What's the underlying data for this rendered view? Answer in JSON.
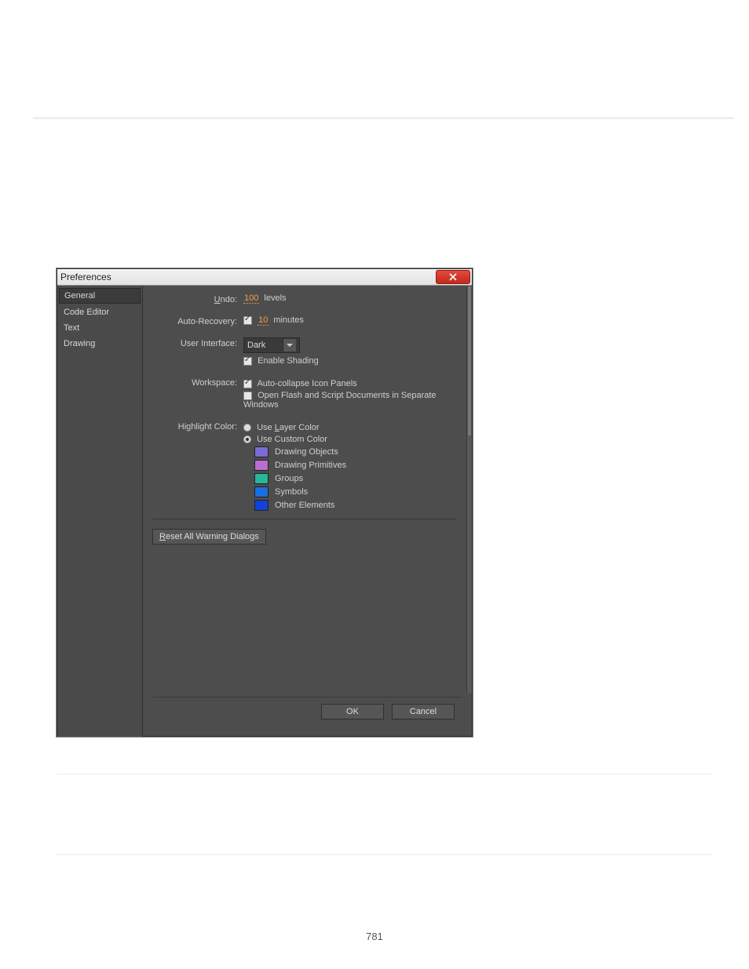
{
  "page": {
    "number": "781"
  },
  "dialog": {
    "title": "Preferences",
    "sidebar": {
      "items": [
        {
          "label": "General",
          "selected": true
        },
        {
          "label": "Code Editor",
          "selected": false
        },
        {
          "label": "Text",
          "selected": false
        },
        {
          "label": "Drawing",
          "selected": false
        }
      ]
    },
    "general": {
      "undo": {
        "label_pre": "U",
        "label_post": "ndo:",
        "value": "100",
        "units": "levels"
      },
      "auto_recovery": {
        "label": "Auto-Recovery:",
        "checked": true,
        "value": "10",
        "units": "minutes"
      },
      "user_interface": {
        "label": "User Interface:",
        "selected": "Dark",
        "enable_shading": {
          "checked": true,
          "label": "Enable Shading"
        }
      },
      "workspace": {
        "label": "Workspace:",
        "auto_collapse": {
          "checked": true,
          "label": "Auto-collapse Icon Panels"
        },
        "separate_windows": {
          "checked": false,
          "label": "Open Flash and Script Documents in Separate Windows"
        }
      },
      "highlight": {
        "label": "Highlight Color:",
        "use_layer": {
          "checked": false,
          "label_pre": "Use ",
          "label_u": "L",
          "label_post": "ayer Color"
        },
        "use_custom": {
          "checked": true,
          "label": "Use Custom Color"
        },
        "items": [
          {
            "color": "#7a6cd6",
            "label": "Drawing Objects"
          },
          {
            "color": "#b86ecf",
            "label": "Drawing Primitives"
          },
          {
            "color": "#27b79a",
            "label": "Groups"
          },
          {
            "color": "#1a6fe0",
            "label": "Symbols"
          },
          {
            "color": "#1441d8",
            "label": "Other Elements"
          }
        ]
      },
      "reset": {
        "label_pre": "R",
        "label_post": "eset All Warning Dialogs"
      }
    },
    "buttons": {
      "ok": "OK",
      "cancel": "Cancel"
    }
  }
}
